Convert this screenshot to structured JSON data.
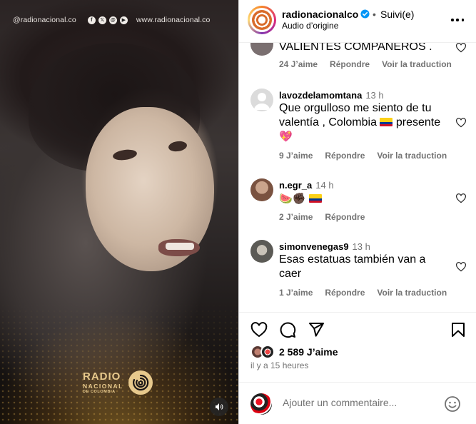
{
  "media": {
    "handle": "@radionacional.co",
    "website": "www.radionacional.co",
    "logo_line1": "RADIO",
    "logo_line2": "NACIONAL",
    "logo_line3": "DE COLOMBIA",
    "social_icons": [
      "facebook-icon",
      "x-icon",
      "threads-icon",
      "youtube-icon"
    ]
  },
  "header": {
    "account": "radionacionalco",
    "verified": true,
    "separator": "•",
    "follow_state": "Suivi(e)",
    "audio": "Audio d’origine"
  },
  "comments": [
    {
      "user": "",
      "time": "",
      "text": "VALIENTES COMPANEROS .",
      "likes": "24 J’aime",
      "reply": "Répondre",
      "translate": "Voir la traduction"
    },
    {
      "user": "lavozdelamomtana",
      "time": "13 h",
      "text_a": "Que orgulloso me siento de tu valentía , Colombia",
      "text_b": "presente",
      "emojis": [
        "colombia-flag",
        "sparkling-heart"
      ],
      "likes": "9 J’aime",
      "reply": "Répondre",
      "translate": "Voir la traduction"
    },
    {
      "user": "n.egr_a",
      "time": "14 h",
      "text": "🍉✊🏿",
      "emojis": [
        "watermelon",
        "raised-fist-dark",
        "colombia-flag"
      ],
      "likes": "2 J’aime",
      "reply": "Répondre"
    },
    {
      "user": "simonvenegas9",
      "time": "13 h",
      "text": "Esas estatuas también van a caer",
      "likes": "1 J’aime",
      "reply": "Répondre",
      "translate": "Voir la traduction"
    }
  ],
  "post": {
    "like_count": "2 589 J’aime",
    "age": "il y a 15 heures"
  },
  "comment_box": {
    "placeholder": "Ajouter un commentaire..."
  },
  "colors": {
    "accent": "#0095f6",
    "muted": "#737373",
    "logo_gold": "#e7c98d"
  }
}
